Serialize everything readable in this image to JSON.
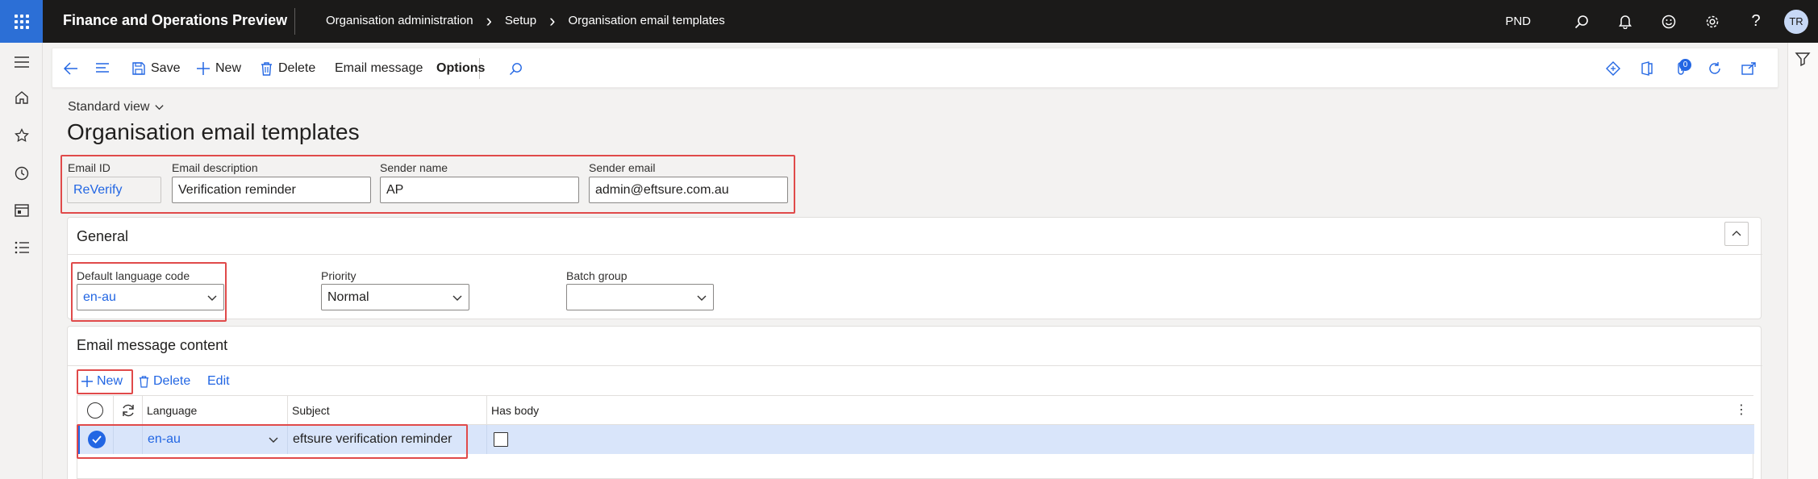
{
  "app": {
    "title": "Finance and Operations Preview",
    "breadcrumbs": [
      "Organisation administration",
      "Setup",
      "Organisation email templates"
    ],
    "company": "PND",
    "user_initials": "TR"
  },
  "actions": {
    "save": "Save",
    "new": "New",
    "delete": "Delete",
    "email_message": "Email message",
    "options": "Options",
    "attachments_count": "0"
  },
  "page": {
    "view": "Standard view",
    "title": "Organisation email templates"
  },
  "header_fields": {
    "email_id": {
      "label": "Email ID",
      "value": "ReVerify"
    },
    "email_description": {
      "label": "Email description",
      "value": "Verification reminder"
    },
    "sender_name": {
      "label": "Sender name",
      "value": "AP"
    },
    "sender_email": {
      "label": "Sender email",
      "value": "admin@eftsure.com.au"
    }
  },
  "general": {
    "title": "General",
    "default_language": {
      "label": "Default language code",
      "value": "en-au"
    },
    "priority": {
      "label": "Priority",
      "value": "Normal"
    },
    "batch_group": {
      "label": "Batch group",
      "value": ""
    }
  },
  "content": {
    "title": "Email message content",
    "toolbar": {
      "new": "New",
      "delete": "Delete",
      "edit": "Edit"
    },
    "columns": [
      "Language",
      "Subject",
      "Has body"
    ],
    "rows": [
      {
        "language": "en-au",
        "subject": "eftsure verification reminder",
        "has_body": false,
        "selected": true
      }
    ]
  },
  "colors": {
    "accent": "#2266e3",
    "topbar": "#1b1a19",
    "highlight_box": "#e04a4a",
    "selected_row": "#d9e5fa"
  },
  "icons": [
    "waffle-icon",
    "search-icon",
    "bell-icon",
    "smiley-icon",
    "gear-icon",
    "help-icon",
    "hamburger-icon",
    "home-icon",
    "star-icon",
    "clock-icon",
    "workspace-icon",
    "list-icon",
    "filter-icon",
    "back-arrow-icon",
    "menu-lines-icon",
    "save-icon",
    "plus-icon",
    "trash-icon",
    "diamond-icon",
    "office-icon",
    "attachment-icon",
    "refresh-icon",
    "popout-icon",
    "chevron-down-icon",
    "chevron-up-icon"
  ]
}
